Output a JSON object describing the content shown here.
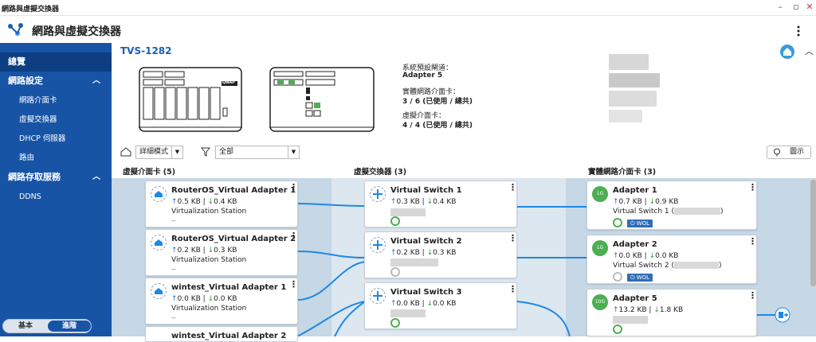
{
  "window": {
    "title": "網路與虛擬交換器",
    "min": "–",
    "max": "▫",
    "close": "✕"
  },
  "app": {
    "title": "網路與虛擬交換器",
    "more": "⋮"
  },
  "sidebar": {
    "overview": "總覽",
    "net_settings": "網路設定",
    "items": [
      "網路介面卡",
      "虛擬交換器",
      "DHCP 伺服器",
      "路由"
    ],
    "storage_services": "網路存取服務",
    "ddns": "DDNS",
    "mode_basic": "基本",
    "mode_advanced": "進階",
    "chevron": "︿"
  },
  "device": {
    "name": "TVS-1282",
    "brand": "QNAP",
    "gateway_label": "系統預設閘道：",
    "gateway_value": "Adapter 5",
    "physical_label": "實體網路介面卡：",
    "physical_value": "3 / 6 (已使用 / 總共)",
    "virtual_label": "虛擬介面卡：",
    "virtual_value": "4 / 4 (已使用 / 總共)"
  },
  "filters": {
    "mode": "詳細模式",
    "scope": "全部",
    "legend": "圖示"
  },
  "columns": {
    "vnic": "虛擬介面卡 (5)",
    "vswitch": "虛擬交換器 (3)",
    "pnic": "實體網路介面卡 (3)"
  },
  "vnics": [
    {
      "name": "RouterOS_Virtual Adapter 1",
      "up": "0.5 KB",
      "down": "0.4 KB",
      "host": "Virtualization Station",
      "extra": "--"
    },
    {
      "name": "RouterOS_Virtual Adapter 2",
      "up": "0.2 KB",
      "down": "0.3 KB",
      "host": "Virtualization Station",
      "extra": "--"
    },
    {
      "name": "wintest_Virtual Adapter 1",
      "up": "0.0 KB",
      "down": "0.0 KB",
      "host": "Virtualization Station",
      "extra": "--"
    },
    {
      "name": "wintest_Virtual Adapter 2"
    }
  ],
  "vswitches": [
    {
      "name": "Virtual Switch 1",
      "up": "0.3 KB",
      "down": "0.4 KB"
    },
    {
      "name": "Virtual Switch 2",
      "up": "0.2 KB",
      "down": "0.3 KB"
    },
    {
      "name": "Virtual Switch 3",
      "up": "0.0 KB",
      "down": "0.0 KB"
    }
  ],
  "pnics": [
    {
      "name": "Adapter 1",
      "badge": "1G",
      "up": "0.7 KB",
      "down": "0.9 KB",
      "switch": "Virtual Switch 1 (",
      "wol": "WOL"
    },
    {
      "name": "Adapter 2",
      "badge": "1G",
      "up": "0.0 KB",
      "down": "0.0 KB",
      "switch": "Virtual Switch 2 (",
      "wol": "WOL"
    },
    {
      "name": "Adapter 5",
      "badge": "10G",
      "up": "13.2 KB",
      "down": "1.8 KB"
    }
  ],
  "separator": "|",
  "up_arrow": "↑",
  "down_arrow": "↓",
  "close_paren": ")",
  "colors": {
    "sidebar": "#1754a6",
    "sidebar_selected": "#0d3e82",
    "accent": "#1a5fb4",
    "green": "#4caf50"
  }
}
